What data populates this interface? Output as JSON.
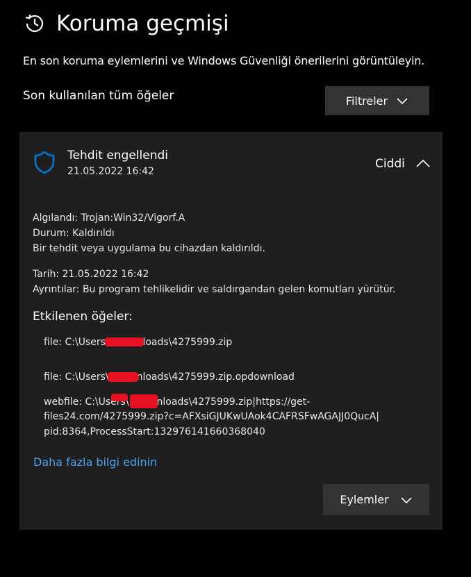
{
  "header": {
    "title": "Koruma geçmişi",
    "icon": "history-icon"
  },
  "subtitle": "En son koruma eylemlerini ve Windows Güvenliği önerilerini görüntüleyin.",
  "filter": {
    "section_label": "Son kullanılan tüm öğeler",
    "button_label": "Filtreler"
  },
  "card": {
    "icon": "shield-icon",
    "title": "Tehdit engellendi",
    "date": "21.05.2022 16:42",
    "severity": "Ciddi",
    "detected": "Algılandı:  Trojan:Win32/Vigorf.A",
    "status": "Durum:  Kaldırıldı",
    "status_desc": "Bir tehdit veya uygulama bu cihazdan kaldırıldı.",
    "date_line": "Tarih:  21.05.2022 16:42",
    "details": "Ayrıntılar:  Bu program tehlikelidir ve saldırgandan gelen komutları yürütür.",
    "affected_title": "Etkilenen öğeler:",
    "affected_items": [
      {
        "line1": "file: C:\\Users\\            \\Downloads\\4275999.zip"
      },
      {
        "line1": "file: C:\\Users\\            \\Downloads\\4275999.zip.opdownload"
      },
      {
        "line1": "webfile: C:\\Users\\            \\Downloads\\4275999.zip|https://get-",
        "line2": "files24.com/4275999.zip?c=AFXsiGJUKwUAok4CAFRSFwAGAJJ0QucA|",
        "line3": "pid:8364,ProcessStart:132976141660368040"
      }
    ],
    "learn_more": "Daha fazla bilgi edinin",
    "actions_label": "Eylemler"
  },
  "colors": {
    "background": "#000000",
    "card": "#1f1f1f",
    "button": "#333333",
    "accent_blue": "#0078d4",
    "link": "#4ca3f0",
    "redaction": "#e81123"
  }
}
